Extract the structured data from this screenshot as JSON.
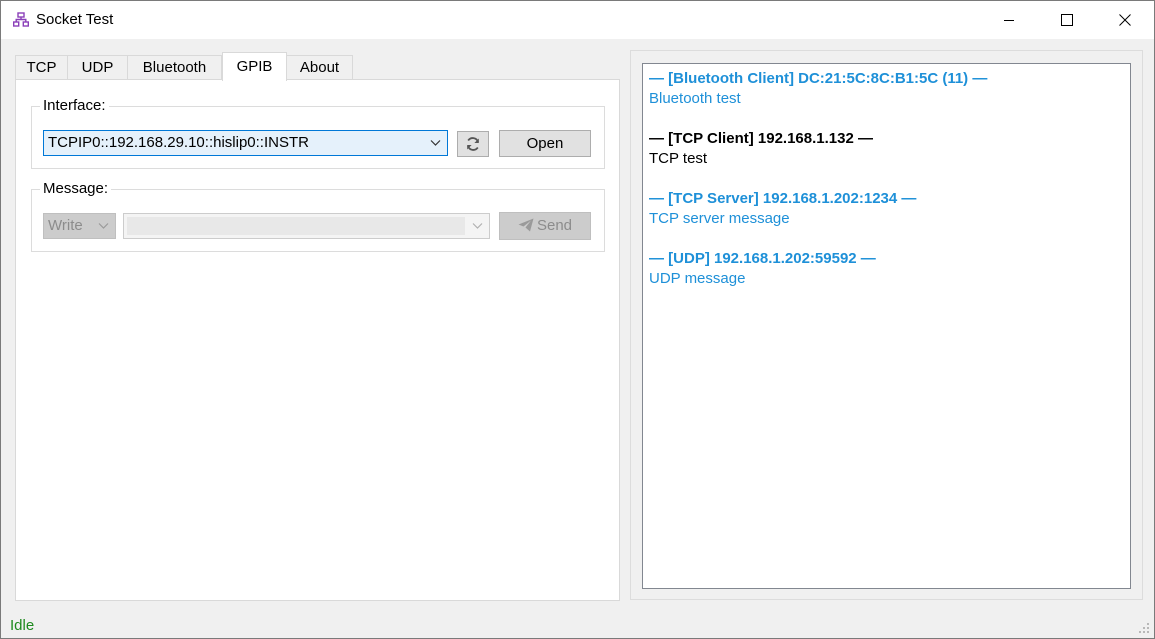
{
  "window": {
    "title": "Socket Test",
    "app_icon": "network-icon",
    "controls": [
      "minimize-icon",
      "maximize-icon",
      "close-icon"
    ]
  },
  "tabs": [
    {
      "label": "TCP",
      "active": false
    },
    {
      "label": "UDP",
      "active": false
    },
    {
      "label": "Bluetooth",
      "active": false
    },
    {
      "label": "GPIB",
      "active": true
    },
    {
      "label": "About",
      "active": false
    }
  ],
  "interface": {
    "legend": "Interface:",
    "selected": "TCPIP0::192.168.29.10::hislip0::INSTR",
    "refresh_icon": "refresh-icon",
    "open_label": "Open"
  },
  "message": {
    "legend": "Message:",
    "mode_selected": "Write",
    "text_value": "",
    "send_label": "Send",
    "send_icon": "paper-plane-icon"
  },
  "log": [
    {
      "header": "— [Bluetooth Client] DC:21:5C:8C:B1:5C (11) —",
      "body": "Bluetooth test",
      "color": "#1e90d8"
    },
    {
      "header": "— [TCP Client] 192.168.1.132 —",
      "body": "TCP test",
      "color": "#000000"
    },
    {
      "header": "— [TCP Server] 192.168.1.202:1234 —",
      "body": "TCP server message",
      "color": "#1e90d8"
    },
    {
      "header": "— [UDP] 192.168.1.202:59592 —",
      "body": "UDP message",
      "color": "#1e90d8"
    }
  ],
  "status": {
    "text": "Idle",
    "color": "#1e8a1e"
  }
}
